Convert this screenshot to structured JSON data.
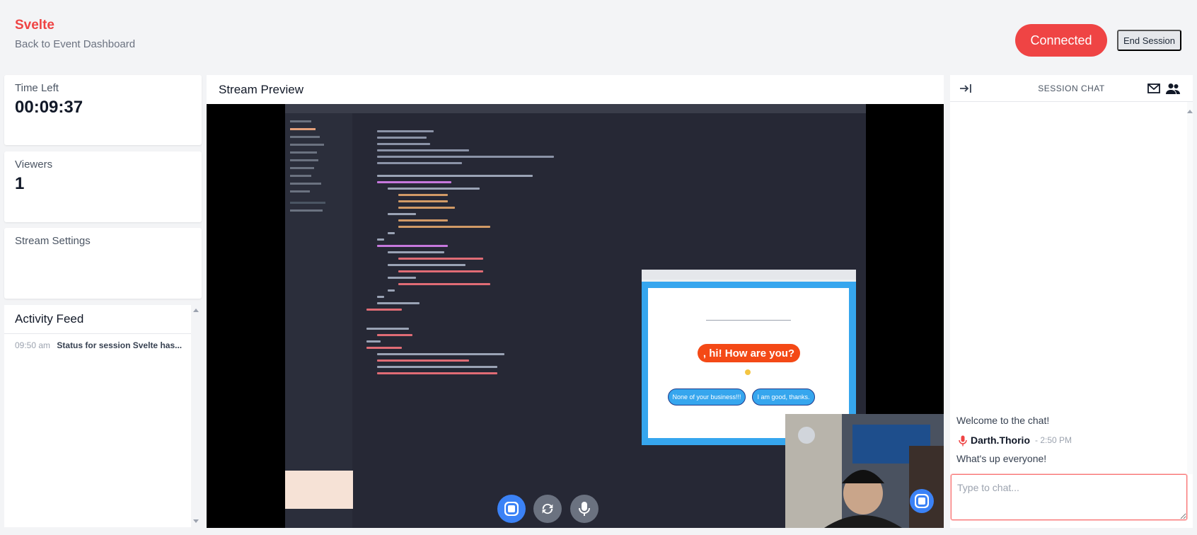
{
  "header": {
    "brand": "Svelte",
    "back_link": "Back to Event Dashboard",
    "connected_label": "Connected",
    "end_session_label": "End Session"
  },
  "stats": {
    "time_left_label": "Time Left",
    "time_left_value": "00:09:37",
    "viewers_label": "Viewers",
    "viewers_value": "1",
    "stream_settings_label": "Stream Settings"
  },
  "activity": {
    "title": "Activity Feed",
    "items": [
      {
        "time": "09:50 am",
        "text": "Status for session Svelte has..."
      }
    ]
  },
  "stream": {
    "title": "Stream Preview",
    "preview_heading": ", hi! How are you?",
    "preview_buttons": [
      "None of your business!!!",
      "I am good, thanks."
    ]
  },
  "chat": {
    "title": "SESSION CHAT",
    "welcome": "Welcome to the chat!",
    "messages": [
      {
        "user": "Darth.Thorio",
        "time": "- 2:50 PM",
        "text": "What's up everyone!"
      }
    ],
    "input_placeholder": "Type to chat..."
  },
  "colors": {
    "accent": "#ef4444",
    "control_blue": "#3b82f6",
    "preview_blue": "#36a6ee",
    "preview_orange": "#f44916"
  },
  "icons": [
    "collapse-right-icon",
    "mail-icon",
    "users-icon",
    "mic-icon",
    "stop-icon",
    "refresh-icon",
    "microphone-icon"
  ]
}
